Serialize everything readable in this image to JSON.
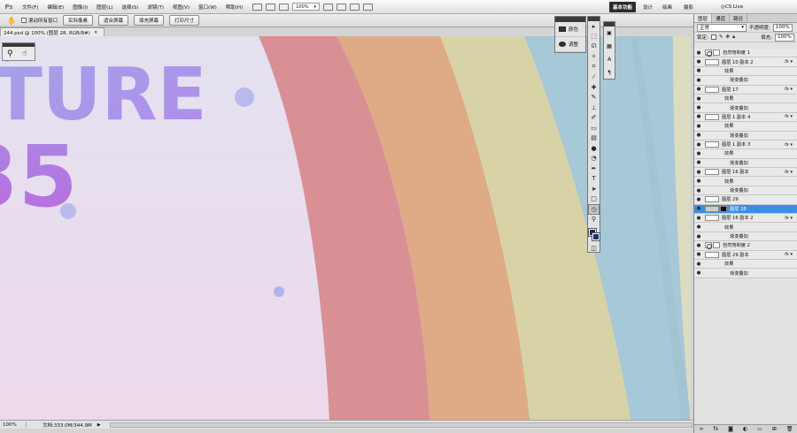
{
  "app": {
    "logo": "Ps"
  },
  "menu": [
    "文件(F)",
    "编辑(E)",
    "图像(I)",
    "图层(L)",
    "选择(S)",
    "滤镜(T)",
    "视图(V)",
    "窗口(W)",
    "帮助(H)"
  ],
  "menubar": {
    "zoom": "100%"
  },
  "workspace": {
    "active": "基本功能",
    "items": [
      "设计",
      "绘画",
      "摄影"
    ],
    "cslive": "CS Live"
  },
  "options": {
    "scroll_all": "滚动所有窗口",
    "buttons": [
      "实际像素",
      "适合屏幕",
      "填充屏幕",
      "打印尺寸"
    ]
  },
  "document": {
    "tab_title": "244.psd @ 100% (图层 28, RGB/8#)",
    "close": "×"
  },
  "canvas_text": {
    "line1": "TURE",
    "line2": "35"
  },
  "status": {
    "zoom": "100%",
    "doc_info": "文档:333.0M/344.9M"
  },
  "adjust_panel": {
    "items": [
      "颜色",
      "调整"
    ]
  },
  "toolbox": {
    "tools": [
      "move-icon",
      "marquee-icon",
      "lasso-icon",
      "magic-wand-icon",
      "crop-icon",
      "eyedropper-icon",
      "heal-icon",
      "brush-icon",
      "stamp-icon",
      "history-brush-icon",
      "eraser-icon",
      "gradient-icon",
      "blur-icon",
      "dodge-icon",
      "pen-icon",
      "type-icon",
      "path-select-icon",
      "shape-icon",
      "rotate-view-icon",
      "zoom-icon"
    ],
    "colors": {
      "foreground": "#14285e",
      "background": "#1d2e74"
    }
  },
  "layers_panel": {
    "tabs": [
      "图层",
      "通道",
      "路径"
    ],
    "blend_mode": "正常",
    "opacity_label": "不透明度:",
    "opacity": "100%",
    "lock_label": "锁定:",
    "fill_label": "填充:",
    "fill": "100%",
    "layers": [
      {
        "name": "自然饱和度 1",
        "type": "adjustment",
        "fx": false,
        "selected": false
      },
      {
        "name": "图层 10 副本 2",
        "type": "layer",
        "fx": true,
        "selected": false
      },
      {
        "name": "效果",
        "type": "effects",
        "fx": false,
        "selected": false
      },
      {
        "name": "渐变叠加",
        "type": "effect",
        "fx": false,
        "selected": false
      },
      {
        "name": "图层 17",
        "type": "layer",
        "fx": true,
        "selected": false
      },
      {
        "name": "效果",
        "type": "effects",
        "fx": false,
        "selected": false
      },
      {
        "name": "渐变叠加",
        "type": "effect",
        "fx": false,
        "selected": false
      },
      {
        "name": "图层 1 副本 4",
        "type": "layer",
        "fx": true,
        "selected": false
      },
      {
        "name": "效果",
        "type": "effects",
        "fx": false,
        "selected": false
      },
      {
        "name": "渐变叠加",
        "type": "effect",
        "fx": false,
        "selected": false
      },
      {
        "name": "图层 1 副本 3",
        "type": "layer",
        "fx": true,
        "selected": false
      },
      {
        "name": "效果",
        "type": "effects",
        "fx": false,
        "selected": false
      },
      {
        "name": "渐变叠加",
        "type": "effect",
        "fx": false,
        "selected": false
      },
      {
        "name": "图层 16 副本",
        "type": "layer",
        "fx": true,
        "selected": false
      },
      {
        "name": "效果",
        "type": "effects",
        "fx": false,
        "selected": false
      },
      {
        "name": "渐变叠加",
        "type": "effect",
        "fx": false,
        "selected": false
      },
      {
        "name": "图层 29",
        "type": "layer",
        "fx": false,
        "selected": false
      },
      {
        "name": "图层 28",
        "type": "masked",
        "fx": false,
        "selected": true
      },
      {
        "name": "图层 16 副本 2",
        "type": "layer",
        "fx": true,
        "selected": false
      },
      {
        "name": "效果",
        "type": "effects",
        "fx": false,
        "selected": false
      },
      {
        "name": "渐变叠加",
        "type": "effect",
        "fx": false,
        "selected": false
      },
      {
        "name": "自然饱和度 2",
        "type": "adjustment",
        "fx": false,
        "selected": false
      },
      {
        "name": "图层 29 副本",
        "type": "layer",
        "fx": true,
        "selected": false
      },
      {
        "name": "效果",
        "type": "effects",
        "fx": false,
        "selected": false
      },
      {
        "name": "渐变叠加",
        "type": "effect",
        "fx": false,
        "selected": false
      }
    ]
  }
}
